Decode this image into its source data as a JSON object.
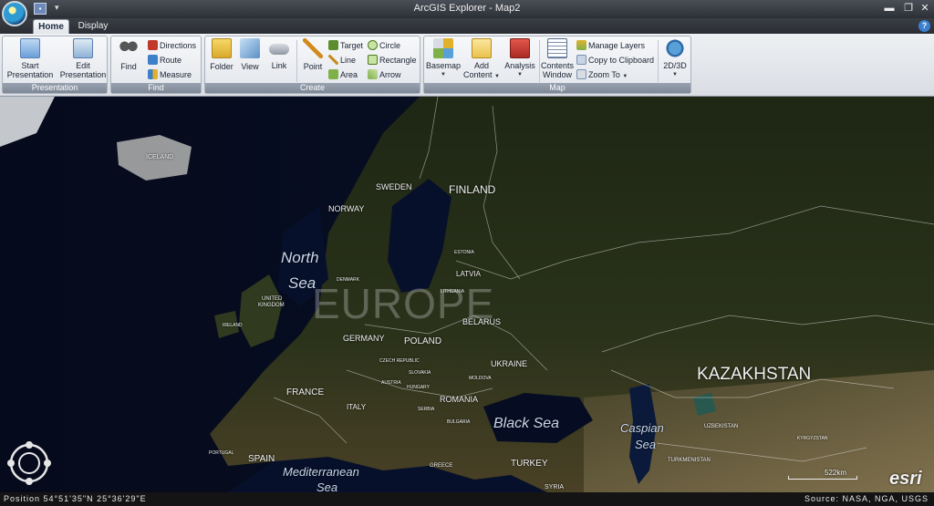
{
  "window": {
    "title": "ArcGIS Explorer - Map2",
    "minimize": "▬",
    "restore": "❐",
    "close": "✕"
  },
  "tabs": [
    {
      "label": "Home"
    },
    {
      "label": "Display"
    }
  ],
  "help": "?",
  "ribbon": {
    "presentation": {
      "label": "Presentation",
      "start_line1": "Start",
      "start_line2": "Presentation",
      "edit_line1": "Edit",
      "edit_line2": "Presentation"
    },
    "find": {
      "label": "Find",
      "find": "Find",
      "directions": "Directions",
      "route": "Route",
      "measure": "Measure"
    },
    "create": {
      "label": "Create",
      "folder": "Folder",
      "view": "View",
      "link": "Link",
      "point": "Point",
      "target": "Target",
      "line": "Line",
      "area": "Area",
      "circle": "Circle",
      "rectangle": "Rectangle",
      "arrow": "Arrow"
    },
    "map": {
      "label": "Map",
      "basemap": "Basemap",
      "add_line1": "Add",
      "add_line2": "Content",
      "analysis": "Analysis",
      "contents_line1": "Contents",
      "contents_line2": "Window",
      "manage_layers": "Manage Layers",
      "copy_clipboard": "Copy to Clipboard",
      "zoom_to": "Zoom To",
      "view_2d3d": "2D/3D"
    }
  },
  "map_labels": {
    "iceland": "ICELAND",
    "sweden": "SWEDEN",
    "finland": "FINLAND",
    "norway": "NORWAY",
    "north_sea_1": "North",
    "north_sea_2": "Sea",
    "estonia": "ESTONIA",
    "latvia": "LATVIA",
    "denmark": "DENMARK",
    "lithuania": "LITHUANIA",
    "united_kingdom_1": "UNITED",
    "united_kingdom_2": "KINGDOM",
    "europe": "EUROPE",
    "ireland": "IRELAND",
    "belarus": "BELARUS",
    "germany": "GERMANY",
    "poland": "POLAND",
    "czech": "CZECH REPUBLIC",
    "ukraine": "UKRAINE",
    "slovakia": "SLOVAKIA",
    "austria": "AUSTRIA",
    "hungary": "HUNGARY",
    "moldova": "MOLDOVA",
    "kazakhstan": "KAZAKHSTAN",
    "france": "FRANCE",
    "romania": "ROMANIA",
    "italy": "ITALY",
    "serbia": "SERBIA",
    "bulgaria": "BULGARIA",
    "black_sea": "Black Sea",
    "caspian_1": "Caspian",
    "caspian_2": "Sea",
    "uzbekistan": "UZBEKISTAN",
    "portugal": "PORTUGAL",
    "spain": "SPAIN",
    "turkey": "TURKEY",
    "turkmenistan": "TURKMENISTAN",
    "kyrgyzstan": "KYRGYZSTAN",
    "mediterranean_1": "Mediterranean",
    "mediterranean_2": "Sea",
    "greece": "GREECE",
    "syria": "SYRIA"
  },
  "scale": {
    "label": "522km"
  },
  "logo": "esri",
  "status": {
    "position": "Position 54°51'35\"N  25°36'29\"E",
    "source": "Source: NASA, NGA, USGS"
  }
}
